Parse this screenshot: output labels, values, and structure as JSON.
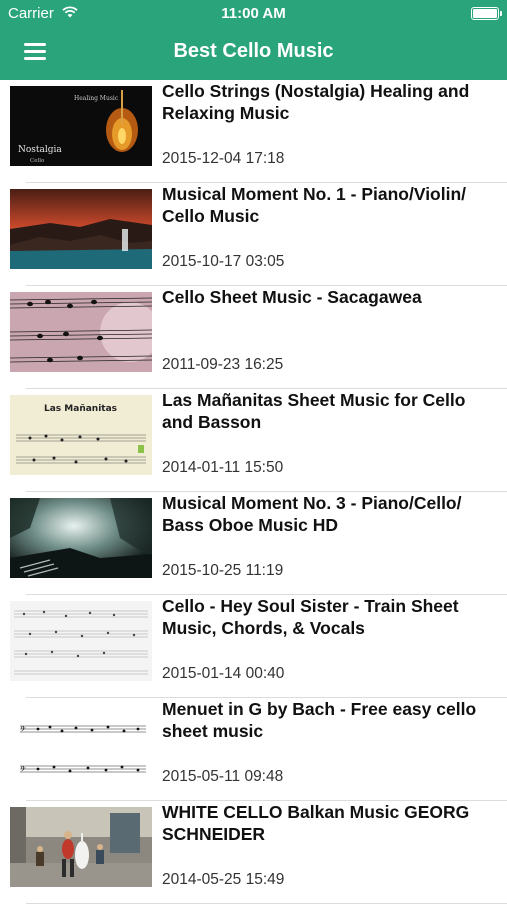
{
  "status": {
    "carrier": "Carrier",
    "time": "11:00 AM"
  },
  "nav": {
    "title": "Best Cello Music",
    "menu_icon": "hamburger-menu-icon"
  },
  "videos": [
    {
      "title": "Cello Strings (Nostalgia)  Healing and Relaxing Music",
      "date": "2015-12-04 17:18",
      "thumb_text": "Nostalgia",
      "thumb_text2": "Healing Music",
      "thumb_text3": "Cello"
    },
    {
      "title": "Musical Moment No. 1 - Piano/Violin/ Cello Music",
      "date": "2015-10-17 03:05"
    },
    {
      "title": "Cello Sheet Music - Sacagawea",
      "date": "2011-09-23 16:25"
    },
    {
      "title": "Las Mañanitas Sheet Music for Cello and Basson",
      "date": "2014-01-11 15:50",
      "thumb_text": "Las Mañanitas"
    },
    {
      "title": "Musical Moment No. 3 - Piano/Cello/ Bass Oboe Music HD",
      "date": "2015-10-25 11:19"
    },
    {
      "title": "Cello - Hey Soul Sister - Train Sheet Music, Chords, & Vocals",
      "date": "2015-01-14 00:40"
    },
    {
      "title": "Menuet in G by Bach - Free easy cello sheet music",
      "date": "2015-05-11 09:48"
    },
    {
      "title": "WHITE CELLO Balkan Music GEORG SCHNEIDER",
      "date": "2014-05-25 15:49"
    }
  ],
  "colors": {
    "accent": "#2aa57b"
  }
}
